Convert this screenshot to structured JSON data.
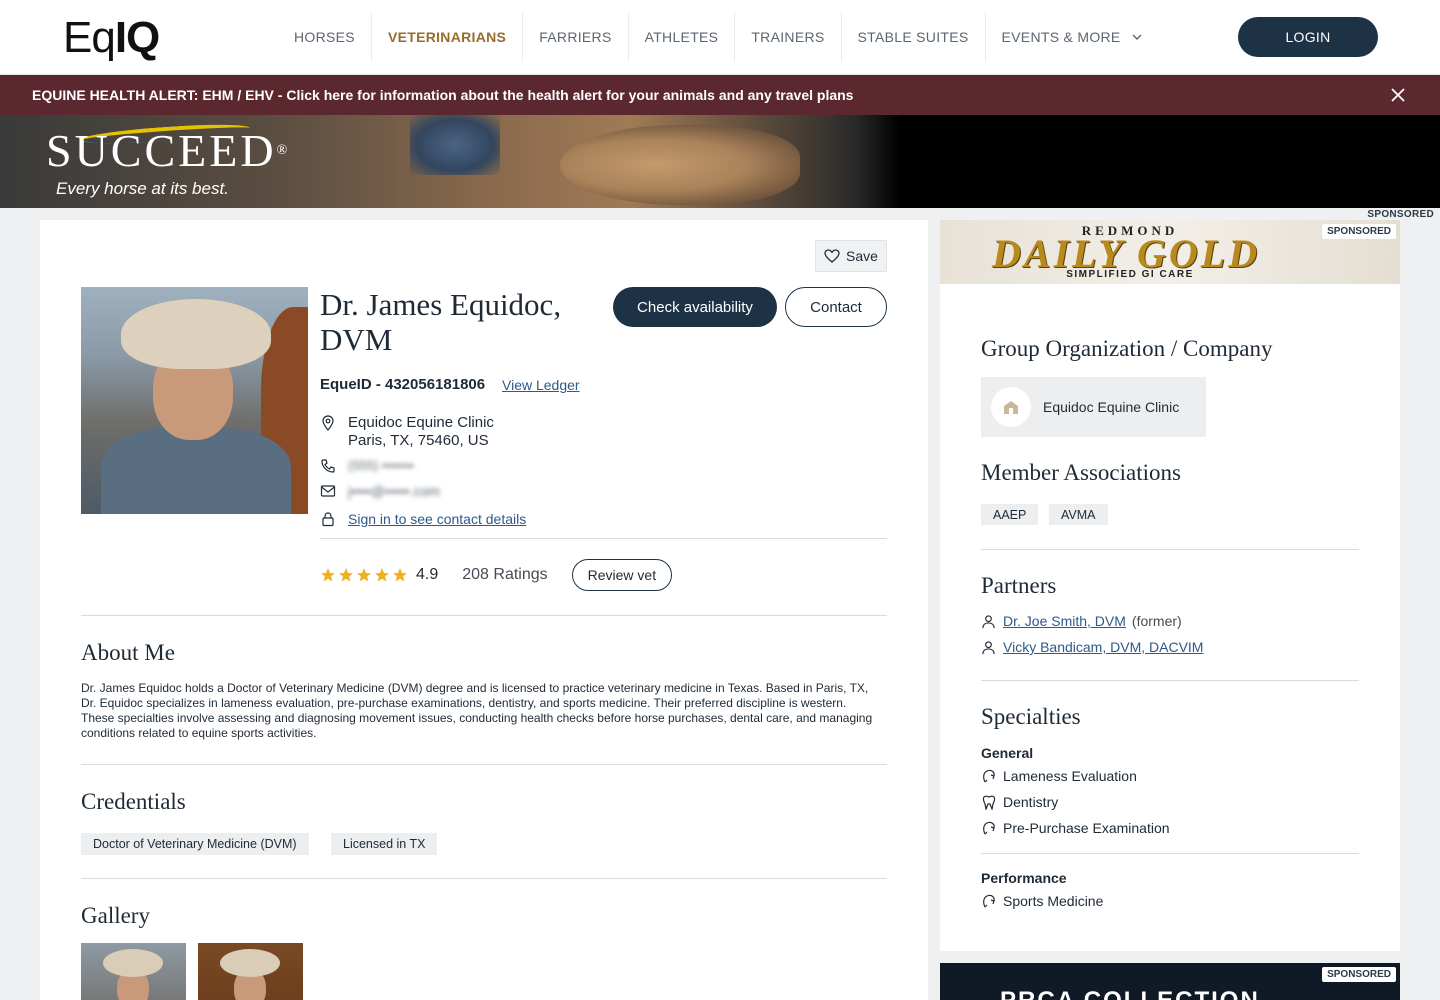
{
  "header": {
    "logo_thin": "Eq",
    "logo_bold": "IQ",
    "nav": [
      {
        "label": "HORSES"
      },
      {
        "label": "VETERINARIANS"
      },
      {
        "label": "FARRIERS"
      },
      {
        "label": "ATHLETES"
      },
      {
        "label": "TRAINERS"
      },
      {
        "label": "STABLE SUITES"
      },
      {
        "label": "EVENTS & MORE"
      }
    ],
    "active_nav": "VETERINARIANS",
    "login_label": "LOGIN"
  },
  "alert": {
    "text": "EQUINE HEALTH ALERT: EHM / EHV - Click here for information about the health alert for your animals and any travel plans",
    "background": "#5b2830"
  },
  "banner_ad": {
    "brand": "SUCCEED",
    "brand_mark": "®",
    "tagline": "Every horse at its best.",
    "sponsored": "SPONSORED"
  },
  "profile": {
    "save_label": "Save",
    "name": "Dr. James Equidoc, DVM",
    "check_availability_label": "Check availability",
    "contact_label": "Contact",
    "equeid": "EqueID - 432056181806",
    "view_ledger_label": "View Ledger",
    "clinic": "Equidoc Equine Clinic",
    "address": "Paris, TX, 75460, US",
    "phone_hidden": "(555) •••••••",
    "email_hidden": "j••••@•••••.com",
    "signin_label": "Sign in to see contact details",
    "rating": "4.9",
    "rating_value": 4.9,
    "rating_max": 5,
    "ratings_count": "208 Ratings",
    "review_label": "Review vet"
  },
  "about": {
    "title": "About Me",
    "text": "Dr. James Equidoc holds a Doctor of Veterinary Medicine (DVM) degree and is licensed to practice veterinary medicine in Texas. Based in Paris, TX, Dr. Equidoc specializes in lameness evaluation, pre-purchase examinations, dentistry, and sports medicine. Their preferred discipline is western. These specialties involve assessing and diagnosing movement issues, conducting health checks before horse purchases, dental care, and managing conditions related to equine sports activities."
  },
  "credentials": {
    "title": "Credentials",
    "items": [
      "Doctor of Veterinary Medicine (DVM)",
      "Licensed in TX"
    ]
  },
  "gallery": {
    "title": "Gallery"
  },
  "side_ad": {
    "brand_top": "REDMOND",
    "brand": "DAILY GOLD",
    "sub": "SIMPLIFIED GI CARE",
    "sponsored": "SPONSORED"
  },
  "sidebar": {
    "group_title": "Group Organization / Company",
    "group_name": "Equidoc Equine Clinic",
    "assoc_title": "Member Associations",
    "associations": [
      "AAEP",
      "AVMA"
    ],
    "partners_title": "Partners",
    "partners": [
      {
        "name": "Dr. Joe Smith, DVM",
        "note": "(former)"
      },
      {
        "name": "Vicky Bandicam, DVM, DACVIM",
        "note": ""
      }
    ],
    "specialties_title": "Specialties",
    "general_label": "General",
    "general": [
      "Lameness Evaluation",
      "Dentistry",
      "Pre-Purchase Examination"
    ],
    "performance_label": "Performance",
    "performance": [
      "Sports Medicine"
    ]
  },
  "bottom_ad": {
    "text": "PRCA COLLECTION",
    "sponsored": "SPONSORED"
  },
  "colors": {
    "accent": "#9a6b2f",
    "primary": "#1e3246",
    "link": "#2c5a8c",
    "star": "#f2b01e"
  }
}
